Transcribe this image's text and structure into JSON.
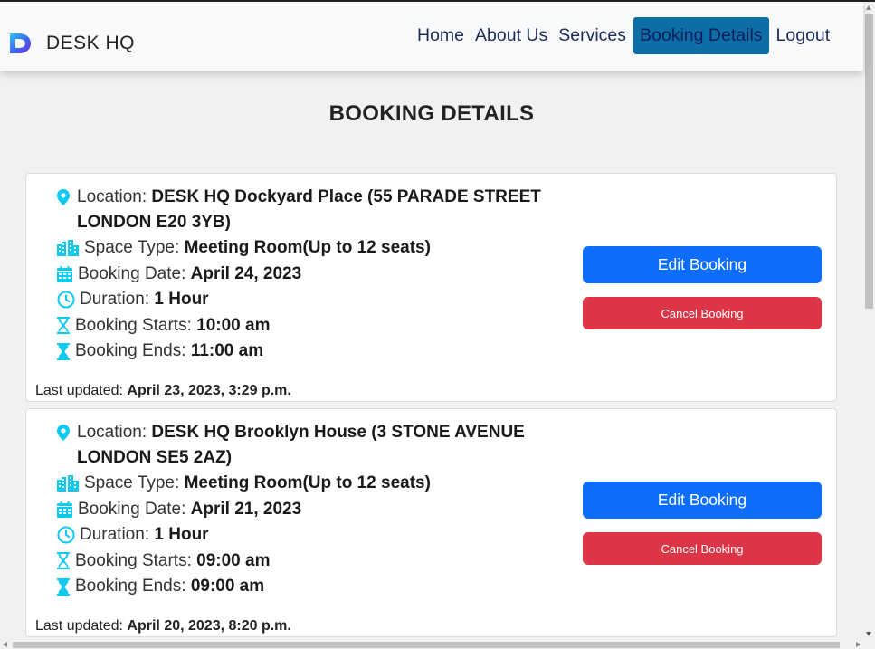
{
  "brand": {
    "name": "DESK HQ",
    "logo_icon": "desk-hq-logo"
  },
  "nav": {
    "items": [
      {
        "label": "Home"
      },
      {
        "label": "About Us"
      },
      {
        "label": "Services"
      },
      {
        "label": "Booking Details",
        "active": true
      },
      {
        "label": "Logout"
      }
    ]
  },
  "page": {
    "title": "BOOKING DETAILS"
  },
  "labels": {
    "location": "Location:",
    "space_type": "Space Type:",
    "booking_date": "Booking Date:",
    "duration": "Duration:",
    "booking_starts": "Booking Starts:",
    "booking_ends": "Booking Ends:",
    "last_updated": "Last updated:",
    "edit_button": "Edit Booking",
    "cancel_button": "Cancel Booking"
  },
  "bookings": [
    {
      "location": "DESK HQ Dockyard Place (55 PARADE STREET LONDON E20 3YB)",
      "space_type": "Meeting Room(Up to 12 seats)",
      "booking_date": "April 24, 2023",
      "duration": "1 Hour",
      "booking_starts": "10:00 am",
      "booking_ends": "11:00 am",
      "last_updated": "April 23, 2023, 3:29 p.m."
    },
    {
      "location": "DESK HQ Brooklyn House (3 STONE AVENUE LONDON SE5 2AZ)",
      "space_type": "Meeting Room(Up to 12 seats)",
      "booking_date": "April 21, 2023",
      "duration": "1 Hour",
      "booking_starts": "09:00 am",
      "booking_ends": "09:00 am",
      "last_updated": "April 20, 2023, 8:20 p.m."
    }
  ],
  "colors": {
    "icon_accent": "#0dcaf0",
    "primary": "#0d6efd",
    "danger": "#dc3545",
    "nav_active": "#0d6ea6"
  }
}
